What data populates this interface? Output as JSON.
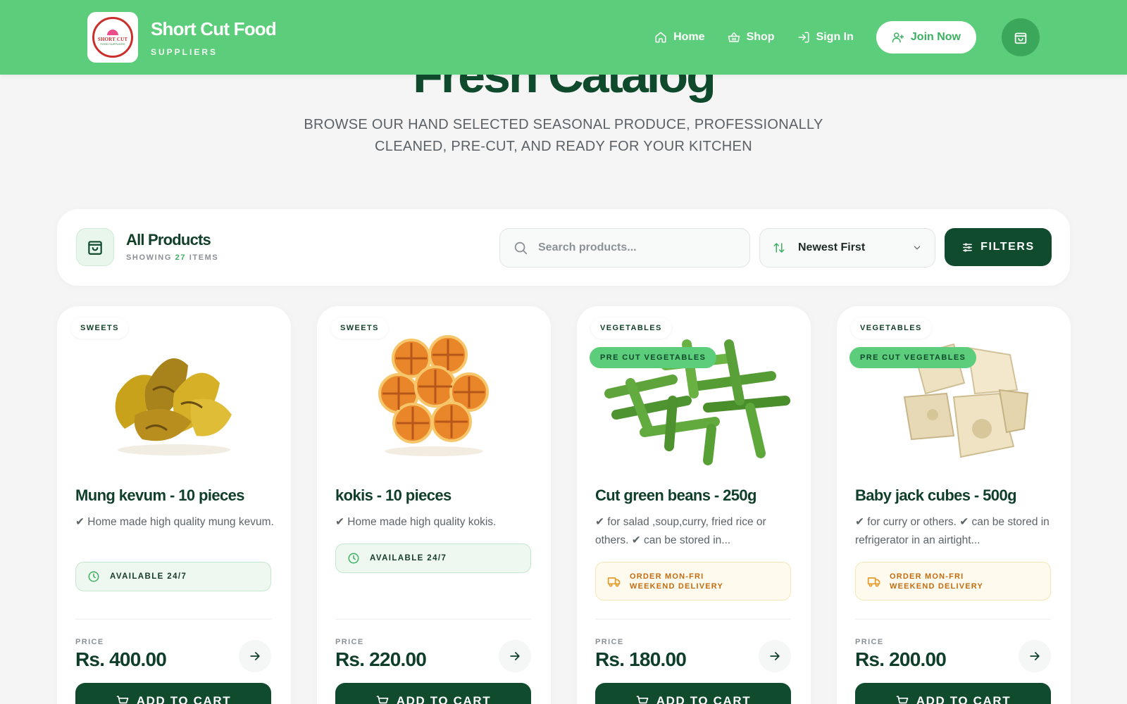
{
  "header": {
    "brand_name": "Short Cut Food",
    "brand_sub": "SUPPLIERS",
    "logo_text": "SHORT CUT",
    "logo_subtext": "FOOD SUPPLIERS",
    "nav": [
      {
        "label": "Home",
        "icon": "home-icon"
      },
      {
        "label": "Shop",
        "icon": "basket-icon"
      },
      {
        "label": "Sign In",
        "icon": "sign-in-icon"
      }
    ],
    "join_label": "Join Now"
  },
  "hero": {
    "title": "Fresh Catalog",
    "subtitle": "BROWSE OUR HAND SELECTED SEASONAL PRODUCE, PROFESSIONALLY CLEANED, PRE-CUT, AND READY FOR YOUR KITCHEN"
  },
  "toolbar": {
    "title": "All Products",
    "count_prefix": "SHOWING",
    "count": "27",
    "count_suffix": "ITEMS",
    "search_placeholder": "Search products...",
    "sort_label": "Newest First",
    "filters_label": "FILTERS"
  },
  "products": [
    {
      "category": "SWEETS",
      "tag": "",
      "name": "Mung kevum - 10 pieces",
      "description": "✔ Home made high quality mung kevum.",
      "availability": "AVAILABLE 24/7",
      "price_label": "PRICE",
      "price": "Rs. 400.00",
      "cart_label": "ADD TO CART"
    },
    {
      "category": "SWEETS",
      "tag": "",
      "name": "kokis - 10 pieces",
      "description": "✔ Home made high quality kokis.",
      "availability": "AVAILABLE 24/7",
      "price_label": "PRICE",
      "price": "Rs. 220.00",
      "cart_label": "ADD TO CART"
    },
    {
      "category": "VEGETABLES",
      "tag": "PRE CUT VEGETABLES",
      "name": "Cut green beans - 250g",
      "description": "✔ for salad ,soup,curry, fried rice or others. ✔ can be stored in...",
      "delivery_line1": "ORDER MON-FRI",
      "delivery_line2": "WEEKEND DELIVERY",
      "price_label": "PRICE",
      "price": "Rs. 180.00",
      "cart_label": "ADD TO CART"
    },
    {
      "category": "VEGETABLES",
      "tag": "PRE CUT VEGETABLES",
      "name": "Baby jack cubes - 500g",
      "description": "✔ for curry or others. ✔ can be stored in refrigerator in an airtight...",
      "delivery_line1": "ORDER MON-FRI",
      "delivery_line2": "WEEKEND DELIVERY",
      "price_label": "PRICE",
      "price": "Rs. 200.00",
      "cart_label": "ADD TO CART"
    }
  ],
  "colors": {
    "header_green": "#5ccd7a",
    "dark_green": "#0f4b2c",
    "accent_green": "#3cb060",
    "delivery_orange": "#c56b10"
  }
}
